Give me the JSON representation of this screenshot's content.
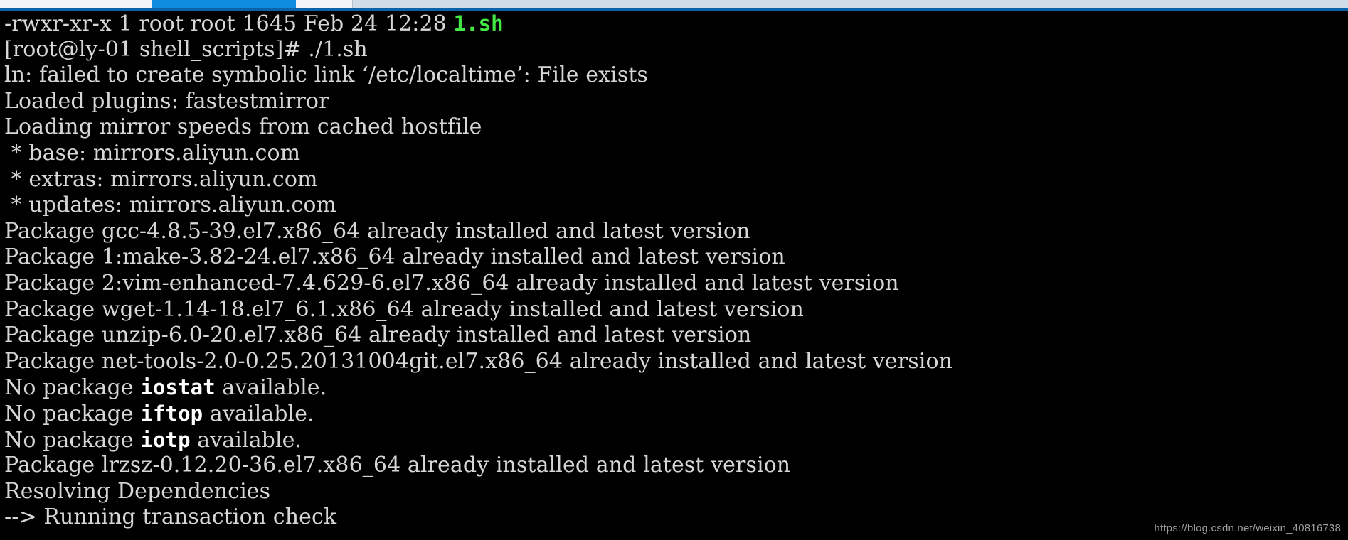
{
  "window": {
    "tabstrip": {
      "active_tab_color": "#0f8ce0",
      "inactive_tab_color": "#f1f3f4",
      "strip_background": "#cfdde9",
      "underline_color": "#0a63a8"
    }
  },
  "terminal": {
    "background_color": "#000000",
    "foreground_color": "#d6d6d6",
    "bold_color": "#ffffff",
    "green_color": "#44e844",
    "lines": [
      {
        "id": "line-ls-entry",
        "segments": [
          {
            "text": "-rwxr-xr-x 1 root root 1645 Feb 24 12:28 ",
            "style": "normal"
          },
          {
            "text": "1.sh",
            "style": "green"
          }
        ]
      },
      {
        "id": "line-prompt-command",
        "segments": [
          {
            "text": "[root@ly-01 shell_scripts]# ./1.sh",
            "style": "normal"
          }
        ]
      },
      {
        "id": "line-ln-error",
        "segments": [
          {
            "text": "ln: failed to create symbolic link ‘/etc/localtime’: File exists",
            "style": "normal"
          }
        ]
      },
      {
        "id": "line-loaded-plugins",
        "segments": [
          {
            "text": "Loaded plugins: fastestmirror",
            "style": "normal"
          }
        ]
      },
      {
        "id": "line-loading-mirror-speeds",
        "segments": [
          {
            "text": "Loading mirror speeds from cached hostfile",
            "style": "normal"
          }
        ]
      },
      {
        "id": "line-mirror-base",
        "segments": [
          {
            "text": " * base: mirrors.aliyun.com",
            "style": "normal"
          }
        ]
      },
      {
        "id": "line-mirror-extras",
        "segments": [
          {
            "text": " * extras: mirrors.aliyun.com",
            "style": "normal"
          }
        ]
      },
      {
        "id": "line-mirror-updates",
        "segments": [
          {
            "text": " * updates: mirrors.aliyun.com",
            "style": "normal"
          }
        ]
      },
      {
        "id": "line-package-gcc",
        "segments": [
          {
            "text": "Package gcc-4.8.5-39.el7.x86_64 already installed and latest version",
            "style": "normal"
          }
        ]
      },
      {
        "id": "line-package-make",
        "segments": [
          {
            "text": "Package 1:make-3.82-24.el7.x86_64 already installed and latest version",
            "style": "normal"
          }
        ]
      },
      {
        "id": "line-package-vim-enhanced",
        "segments": [
          {
            "text": "Package 2:vim-enhanced-7.4.629-6.el7.x86_64 already installed and latest version",
            "style": "normal"
          }
        ]
      },
      {
        "id": "line-package-wget",
        "segments": [
          {
            "text": "Package wget-1.14-18.el7_6.1.x86_64 already installed and latest version",
            "style": "normal"
          }
        ]
      },
      {
        "id": "line-package-unzip",
        "segments": [
          {
            "text": "Package unzip-6.0-20.el7.x86_64 already installed and latest version",
            "style": "normal"
          }
        ]
      },
      {
        "id": "line-package-net-tools",
        "segments": [
          {
            "text": "Package net-tools-2.0-0.25.20131004git.el7.x86_64 already installed and latest version",
            "style": "normal"
          }
        ]
      },
      {
        "id": "line-no-package-iostat",
        "segments": [
          {
            "text": "No package ",
            "style": "normal"
          },
          {
            "text": "iostat",
            "style": "bright"
          },
          {
            "text": " available.",
            "style": "normal"
          }
        ]
      },
      {
        "id": "line-no-package-iftop",
        "segments": [
          {
            "text": "No package ",
            "style": "normal"
          },
          {
            "text": "iftop",
            "style": "bright"
          },
          {
            "text": " available.",
            "style": "normal"
          }
        ]
      },
      {
        "id": "line-no-package-iotp",
        "segments": [
          {
            "text": "No package ",
            "style": "normal"
          },
          {
            "text": "iotp",
            "style": "bright"
          },
          {
            "text": " available.",
            "style": "normal"
          }
        ]
      },
      {
        "id": "line-package-lrzsz",
        "segments": [
          {
            "text": "Package lrzsz-0.12.20-36.el7.x86_64 already installed and latest version",
            "style": "normal"
          }
        ]
      },
      {
        "id": "line-resolving-dependencies",
        "segments": [
          {
            "text": "Resolving Dependencies",
            "style": "normal"
          }
        ]
      },
      {
        "id": "line-running-transaction-check",
        "segments": [
          {
            "text": "--> Running transaction check",
            "style": "normal"
          }
        ]
      }
    ]
  },
  "watermark": {
    "text": "https://blog.csdn.net/weixin_40816738"
  }
}
